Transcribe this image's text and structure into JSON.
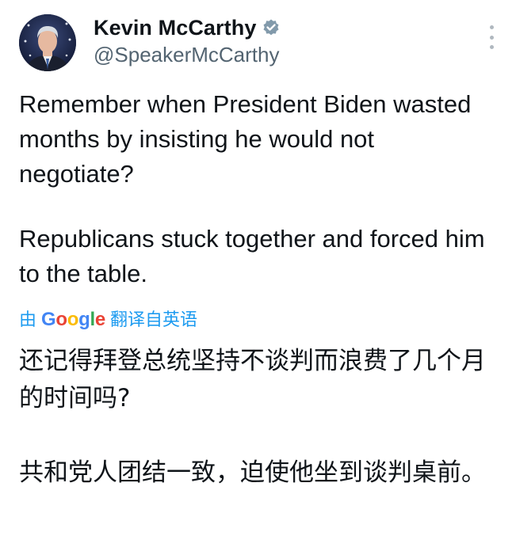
{
  "author": {
    "display_name": "Kevin McCarthy",
    "handle": "@SpeakerMcCarthy",
    "verified_icon": "verified-badge-icon",
    "avatar_icon": "profile-photo"
  },
  "tweet": {
    "paragraphs": [
      "Remember when President Biden wasted months by insisting he would not negotiate?",
      "Republicans stuck together and forced him to the table."
    ]
  },
  "translation": {
    "prefix": "由",
    "provider": "Google",
    "suffix": "翻译自英语",
    "paragraphs": [
      "还记得拜登总统坚持不谈判而浪费了几个月的时间吗?",
      "共和党人团结一致，迫使他坐到谈判桌前。"
    ]
  },
  "colors": {
    "link": "#1d9bf0",
    "secondary_text": "#536471",
    "verified_badge": "#829aab"
  }
}
